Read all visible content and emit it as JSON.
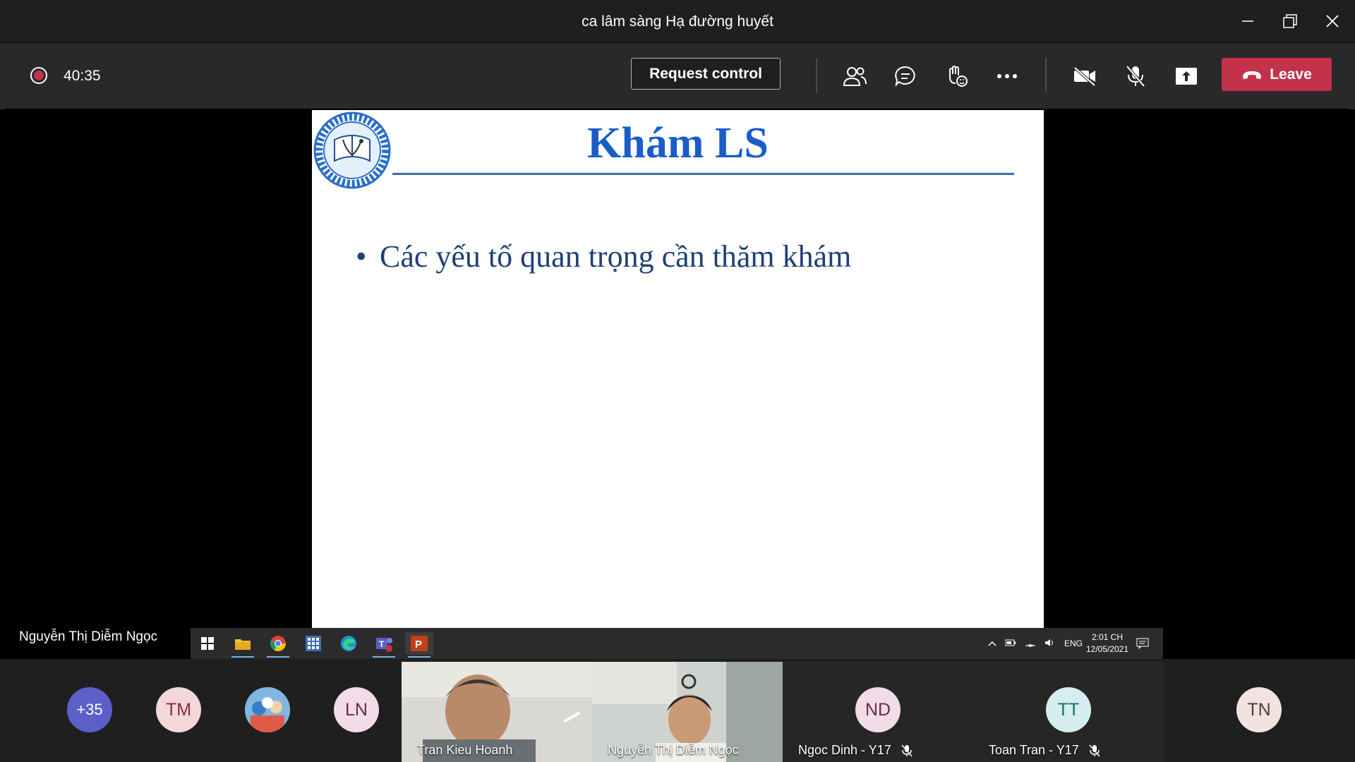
{
  "window": {
    "title": "ca lâm sàng Hạ đường huyết",
    "icons": [
      "minimize-icon",
      "restore-icon",
      "close-icon"
    ]
  },
  "toolbar": {
    "timer": "40:35",
    "request_control_label": "Request control",
    "leave_label": "Leave",
    "icons": [
      "participants-icon",
      "chat-icon",
      "reactions-icon",
      "more-icon",
      "camera-off-icon",
      "mic-off-icon",
      "share-icon",
      "hangup-icon"
    ],
    "leave_color": "#c4314b"
  },
  "slide": {
    "title": "Khám LS",
    "bullet": "Các yếu tố quan trọng cần thăm khám",
    "title_color": "#1a5cc8"
  },
  "presenter": {
    "name": "Nguyễn Thị Diễm Ngọc"
  },
  "taskbar": {
    "language": "ENG",
    "time": "2:01 CH",
    "date": "12/05/2021",
    "apps": [
      "windows-start-icon",
      "file-explorer-icon",
      "chrome-icon",
      "calculator-icon",
      "edge-icon",
      "teams-icon",
      "powerpoint-icon"
    ]
  },
  "participants": {
    "overflow": "+35",
    "avatars": [
      {
        "initials": "TM",
        "bg": "#f4d7d9",
        "fg": "#8a2a33"
      },
      {
        "initials": "LN",
        "bg": "#f2dce8",
        "fg": "#6b2a50"
      }
    ],
    "video_tiles": [
      {
        "name": "Tran Kieu Hoanh"
      },
      {
        "name": "Nguyễn Thị Diễm Ngọc"
      }
    ],
    "audio_tiles": [
      {
        "initials": "ND",
        "name": "Ngoc Dinh - Y17",
        "bg": "#f2dce8",
        "fg": "#6b2a50"
      },
      {
        "initials": "TT",
        "name": "Toan Tran - Y17",
        "bg": "#d6eef0",
        "fg": "#1c6b72"
      },
      {
        "initials": "TN",
        "name": "",
        "bg": "#f1e4e0",
        "fg": "#5a3a30"
      }
    ]
  }
}
